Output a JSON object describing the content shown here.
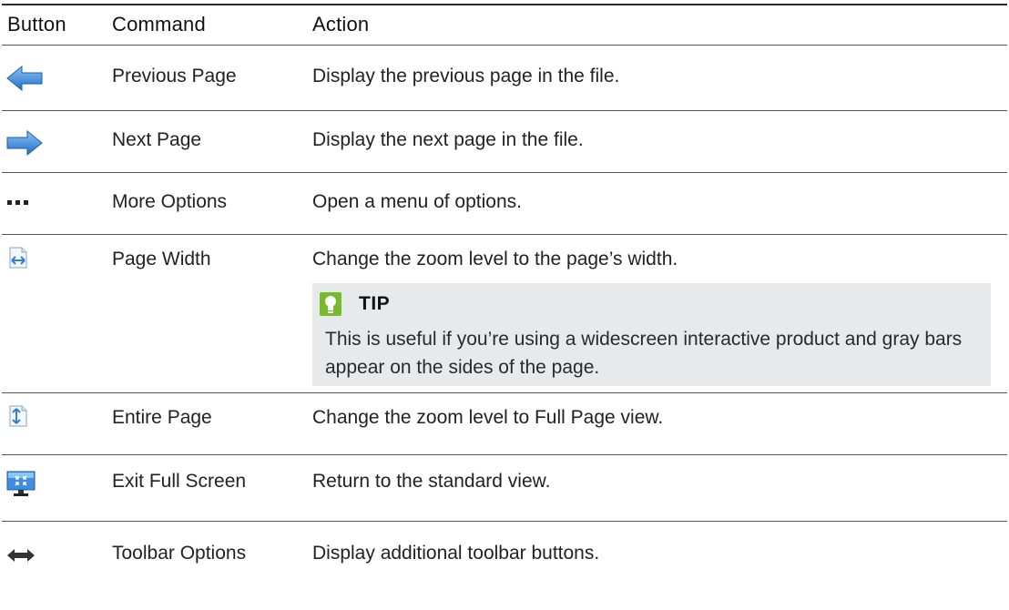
{
  "table": {
    "headers": {
      "button": "Button",
      "command": "Command",
      "action": "Action"
    },
    "rows": [
      {
        "icon": "previous-page-arrow-icon",
        "command": "Previous Page",
        "action": "Display the previous page in the file."
      },
      {
        "icon": "next-page-arrow-icon",
        "command": "Next Page",
        "action": "Display the next page in the file."
      },
      {
        "icon": "more-options-ellipsis-icon",
        "command": "More Options",
        "action": "Open a menu of options."
      },
      {
        "icon": "page-width-icon",
        "command": "Page Width",
        "action": "Change the zoom level to the page’s width."
      },
      {
        "icon": "entire-page-icon",
        "command": "Entire Page",
        "action": "Change the zoom level to Full Page view."
      },
      {
        "icon": "exit-full-screen-icon",
        "command": "Exit Full Screen",
        "action": "Return to the standard view."
      },
      {
        "icon": "toolbar-options-double-arrow-icon",
        "command": "Toolbar Options",
        "action": "Display additional toolbar buttons."
      }
    ]
  },
  "tip": {
    "icon": "lightbulb-icon",
    "title": "TIP",
    "body": "This is useful if you’re using a widescreen interactive product and gray bars appear on the sides of the page."
  },
  "colors": {
    "rule": "#555555",
    "tip_background": "#e8e9ea",
    "tip_icon": "#77bb2a",
    "arrow_blue": "#2f7fd1"
  }
}
